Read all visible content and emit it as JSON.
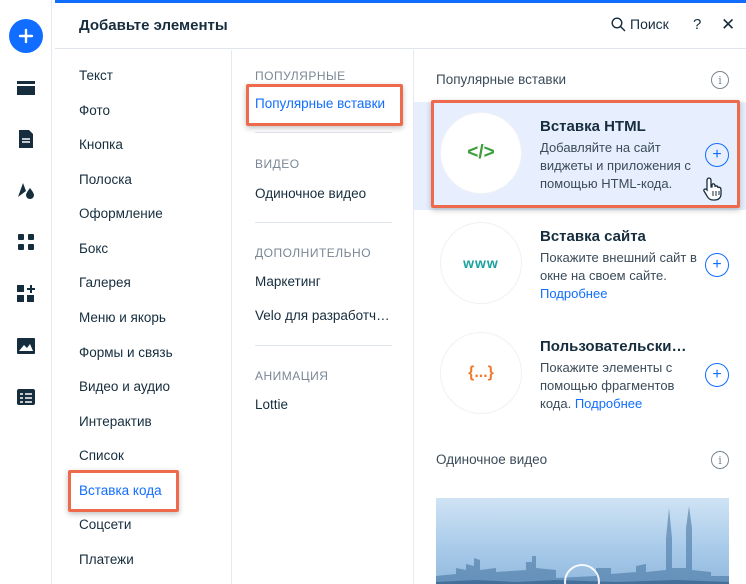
{
  "header": {
    "title": "Добавьте элементы",
    "search_label": "Поиск",
    "help_label": "?",
    "close_label": "✕"
  },
  "rail": {
    "icons": [
      "add-icon",
      "strip-icon",
      "page-icon",
      "design-icon",
      "apps-icon",
      "puzzle-icon",
      "image-icon",
      "table-icon"
    ]
  },
  "categories": [
    "Текст",
    "Фото",
    "Кнопка",
    "Полоска",
    "Оформление",
    "Бокс",
    "Галерея",
    "Меню и якорь",
    "Формы и связь",
    "Видео и аудио",
    "Интерактив",
    "Список",
    "Вставка кода",
    "Соцсети",
    "Платежи"
  ],
  "active_category": "Вставка кода",
  "subcategories": {
    "popular_header": "ПОПУЛЯРНЫЕ",
    "popular_item": "Популярные вставки",
    "video_header": "ВИДЕО",
    "video_item": "Одиночное видео",
    "extra_header": "ДОПОЛНИТЕЛЬНО",
    "extra_items": [
      "Маркетинг",
      "Velo для разработчиков"
    ],
    "animation_header": "АНИМАЦИЯ",
    "animation_item": "Lottie"
  },
  "content": {
    "popular_group_title": "Популярные вставки",
    "info_label": "i",
    "cards": [
      {
        "icon": "</>",
        "icon_color": "#3a9f3a",
        "title": "Вставка HTML",
        "desc": "Добавляйте на сайт виджеты и приложения с помощью HTML-кода.",
        "more": ""
      },
      {
        "icon": "www",
        "icon_color": "#1aa2a0",
        "title": "Вставка сайта",
        "desc": "Покажите внешний сайт в окне на своем сайте. ",
        "more": "Подробнее"
      },
      {
        "icon": "{...}",
        "icon_color": "#f07a2c",
        "title": "Пользовательский элемент",
        "desc": "Покажите элементы с помощью фрагментов кода. ",
        "more": "Подробнее"
      }
    ],
    "video_group_title": "Одиночное видео",
    "plus_label": "+"
  },
  "colors": {
    "accent": "#116dff",
    "highlight": "#ee6a4c",
    "selected_card_bg": "#e7efff"
  }
}
